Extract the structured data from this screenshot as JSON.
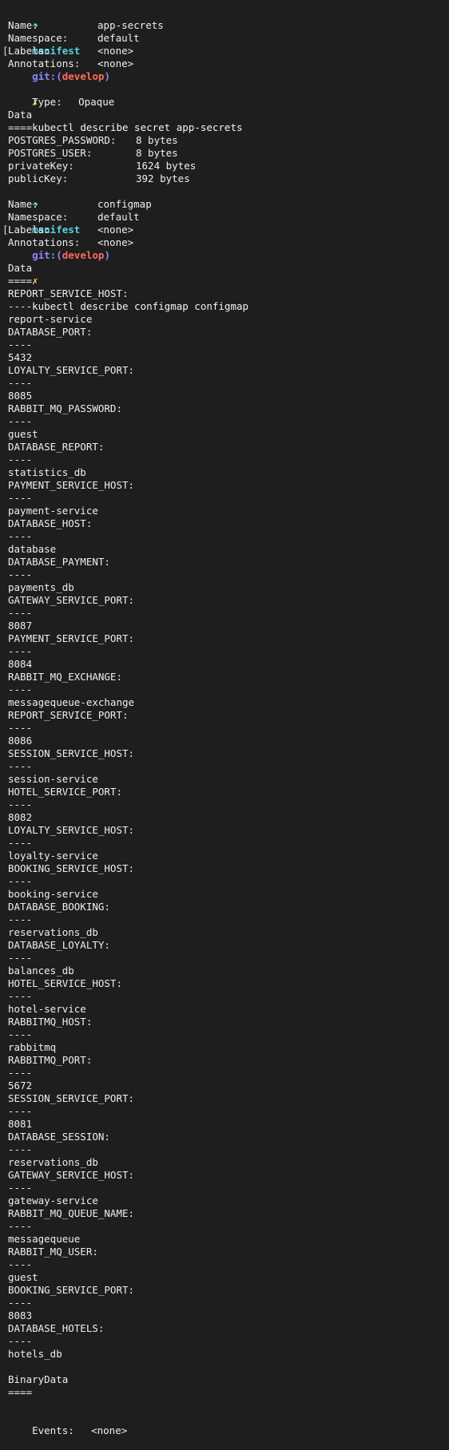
{
  "theme": {
    "background": "#1e1e1e",
    "text": "#eeeeee",
    "arrow": "#57d38c",
    "directory": "#5ccfe6",
    "git": "#8f87ff",
    "branch": "#ff6b5a",
    "dirty": "#f6d14d"
  },
  "prompts": [
    {
      "arrow": "➜",
      "directory": "manifest",
      "git_prefix": "git:(",
      "branch": "develop",
      "git_suffix": ")",
      "dirty": "✗",
      "command": "kubectl describe secret app-secrets"
    },
    {
      "arrow": "➜",
      "directory": "manifest",
      "git_prefix": "git:(",
      "branch": "develop",
      "git_suffix": ")",
      "dirty": "✗",
      "command": "kubectl describe configmap configmap"
    }
  ],
  "secret": {
    "meta": [
      {
        "key": "Name:",
        "value": "app-secrets"
      },
      {
        "key": "Namespace:",
        "value": "default"
      },
      {
        "key": "Labels:",
        "value": "<none>"
      },
      {
        "key": "Annotations:",
        "value": "<none>"
      }
    ],
    "type_key": "Type:",
    "type_value": "Opaque",
    "data_title": "Data",
    "data_underline": "====",
    "data": [
      {
        "key": "POSTGRES_PASSWORD:",
        "value": "8 bytes"
      },
      {
        "key": "POSTGRES_USER:",
        "value": "8 bytes"
      },
      {
        "key": "privateKey:",
        "value": "1624 bytes"
      },
      {
        "key": "publicKey:",
        "value": "392 bytes"
      }
    ]
  },
  "configmap": {
    "meta": [
      {
        "key": "Name:",
        "value": "configmap"
      },
      {
        "key": "Namespace:",
        "value": "default"
      },
      {
        "key": "Labels:",
        "value": "<none>"
      },
      {
        "key": "Annotations:",
        "value": "<none>"
      }
    ],
    "data_title": "Data",
    "data_underline": "====",
    "separator": "----",
    "entries": [
      {
        "key": "REPORT_SERVICE_HOST:",
        "value": "report-service"
      },
      {
        "key": "DATABASE_PORT:",
        "value": "5432"
      },
      {
        "key": "LOYALTY_SERVICE_PORT:",
        "value": "8085"
      },
      {
        "key": "RABBIT_MQ_PASSWORD:",
        "value": "guest"
      },
      {
        "key": "DATABASE_REPORT:",
        "value": "statistics_db"
      },
      {
        "key": "PAYMENT_SERVICE_HOST:",
        "value": "payment-service"
      },
      {
        "key": "DATABASE_HOST:",
        "value": "database"
      },
      {
        "key": "DATABASE_PAYMENT:",
        "value": "payments_db"
      },
      {
        "key": "GATEWAY_SERVICE_PORT:",
        "value": "8087"
      },
      {
        "key": "PAYMENT_SERVICE_PORT:",
        "value": "8084"
      },
      {
        "key": "RABBIT_MQ_EXCHANGE:",
        "value": "messagequeue-exchange"
      },
      {
        "key": "REPORT_SERVICE_PORT:",
        "value": "8086"
      },
      {
        "key": "SESSION_SERVICE_HOST:",
        "value": "session-service"
      },
      {
        "key": "HOTEL_SERVICE_PORT:",
        "value": "8082"
      },
      {
        "key": "LOYALTY_SERVICE_HOST:",
        "value": "loyalty-service"
      },
      {
        "key": "BOOKING_SERVICE_HOST:",
        "value": "booking-service"
      },
      {
        "key": "DATABASE_BOOKING:",
        "value": "reservations_db"
      },
      {
        "key": "DATABASE_LOYALTY:",
        "value": "balances_db"
      },
      {
        "key": "HOTEL_SERVICE_HOST:",
        "value": "hotel-service"
      },
      {
        "key": "RABBITMQ_HOST:",
        "value": "rabbitmq"
      },
      {
        "key": "RABBITMQ_PORT:",
        "value": "5672"
      },
      {
        "key": "SESSION_SERVICE_PORT:",
        "value": "8081"
      },
      {
        "key": "DATABASE_SESSION:",
        "value": "reservations_db"
      },
      {
        "key": "GATEWAY_SERVICE_HOST:",
        "value": "gateway-service"
      },
      {
        "key": "RABBIT_MQ_QUEUE_NAME:",
        "value": "messagequeue"
      },
      {
        "key": "RABBIT_MQ_USER:",
        "value": "guest"
      },
      {
        "key": "BOOKING_SERVICE_PORT:",
        "value": "8083"
      },
      {
        "key": "DATABASE_HOTELS:",
        "value": "hotels_db"
      }
    ],
    "binary_title": "BinaryData",
    "binary_underline": "====",
    "events_key": "Events:",
    "events_value": "<none>"
  }
}
